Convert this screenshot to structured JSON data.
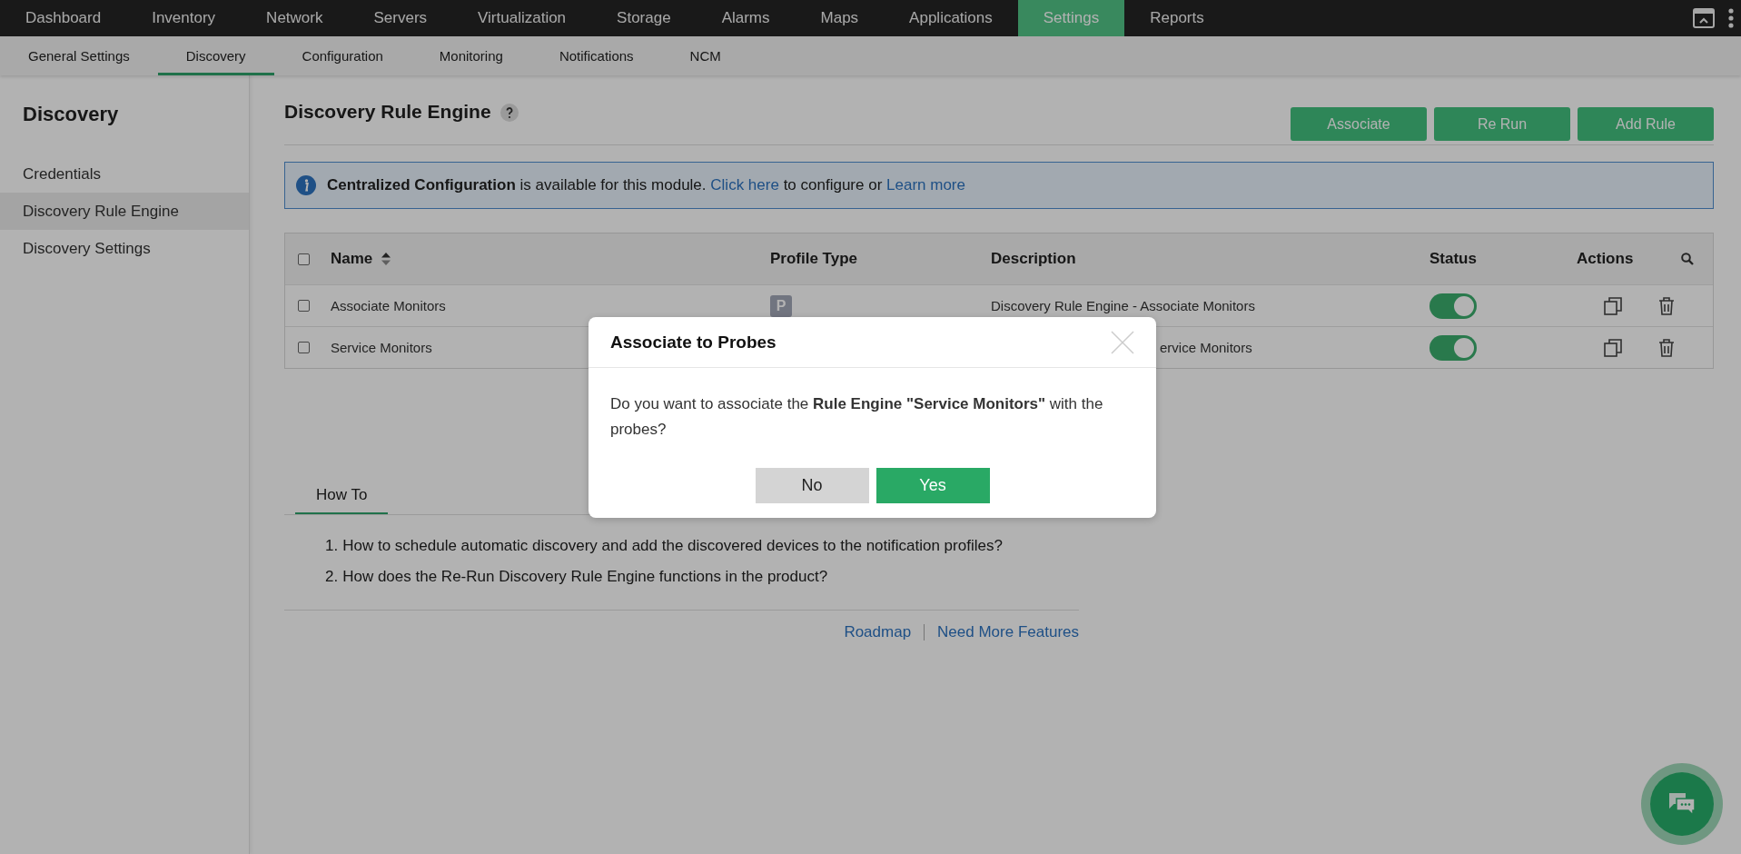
{
  "top_nav": [
    {
      "label": "Dashboard",
      "selected": false
    },
    {
      "label": "Inventory",
      "selected": false
    },
    {
      "label": "Network",
      "selected": false
    },
    {
      "label": "Servers",
      "selected": false
    },
    {
      "label": "Virtualization",
      "selected": false
    },
    {
      "label": "Storage",
      "selected": false
    },
    {
      "label": "Alarms",
      "selected": false
    },
    {
      "label": "Maps",
      "selected": false
    },
    {
      "label": "Applications",
      "selected": false
    },
    {
      "label": "Settings",
      "selected": true
    },
    {
      "label": "Reports",
      "selected": false
    }
  ],
  "sub_nav": [
    {
      "label": "General Settings",
      "selected": false
    },
    {
      "label": "Discovery",
      "selected": true
    },
    {
      "label": "Configuration",
      "selected": false
    },
    {
      "label": "Monitoring",
      "selected": false
    },
    {
      "label": "Notifications",
      "selected": false
    },
    {
      "label": "NCM",
      "selected": false
    }
  ],
  "sidebar": {
    "title": "Discovery",
    "items": [
      {
        "label": "Credentials",
        "selected": false
      },
      {
        "label": "Discovery Rule Engine",
        "selected": true
      },
      {
        "label": "Discovery Settings",
        "selected": false
      }
    ]
  },
  "page": {
    "title": "Discovery Rule Engine",
    "buttons": [
      "Associate",
      "Re Run",
      "Add Rule"
    ]
  },
  "banner": {
    "parts": [
      {
        "kind": "text",
        "text": "**Centralized Configuration** is available for this module."
      },
      {
        "kind": "link",
        "text": "Click here"
      },
      {
        "kind": "text",
        "text": "to configure or"
      },
      {
        "kind": "link",
        "text": "Learn more"
      }
    ]
  },
  "table": {
    "select_all_checked": false,
    "columns": [
      {
        "label": "Name",
        "sortable": true
      },
      {
        "label": "Profile Type",
        "sortable": false
      },
      {
        "label": "Description",
        "sortable": false
      },
      {
        "label": "Status",
        "sortable": false
      },
      {
        "label": "Actions",
        "sortable": false
      }
    ],
    "rows": [
      {
        "checked": false,
        "name": "Associate Monitors",
        "profile_type": "P",
        "description": "Discovery Rule Engine - Associate Monitors",
        "description_cut": false,
        "enabled": true
      },
      {
        "checked": false,
        "name": "Service Monitors",
        "description": "ervice Monitors",
        "description_cut": true,
        "enabled": true
      }
    ]
  },
  "how_to": {
    "tabs": [
      {
        "label": "How To",
        "selected": true
      }
    ],
    "items": [
      {
        "number": "1.",
        "text": "How to schedule automatic discovery and add the discovered devices to the notification profiles?"
      },
      {
        "number": "2.",
        "text": "How does the Re-Run Discovery Rule Engine functions in the product?"
      }
    ],
    "links": [
      "Roadmap",
      "Need More Features"
    ]
  },
  "dialog": {
    "title": "Associate to Probes",
    "message": "Do you want to associate the **Rule Engine \"Service Monitors\"** with the probes?",
    "buttons": [
      {
        "label": "No",
        "kind": "secondary"
      },
      {
        "label": "Yes",
        "kind": "primary"
      }
    ]
  }
}
